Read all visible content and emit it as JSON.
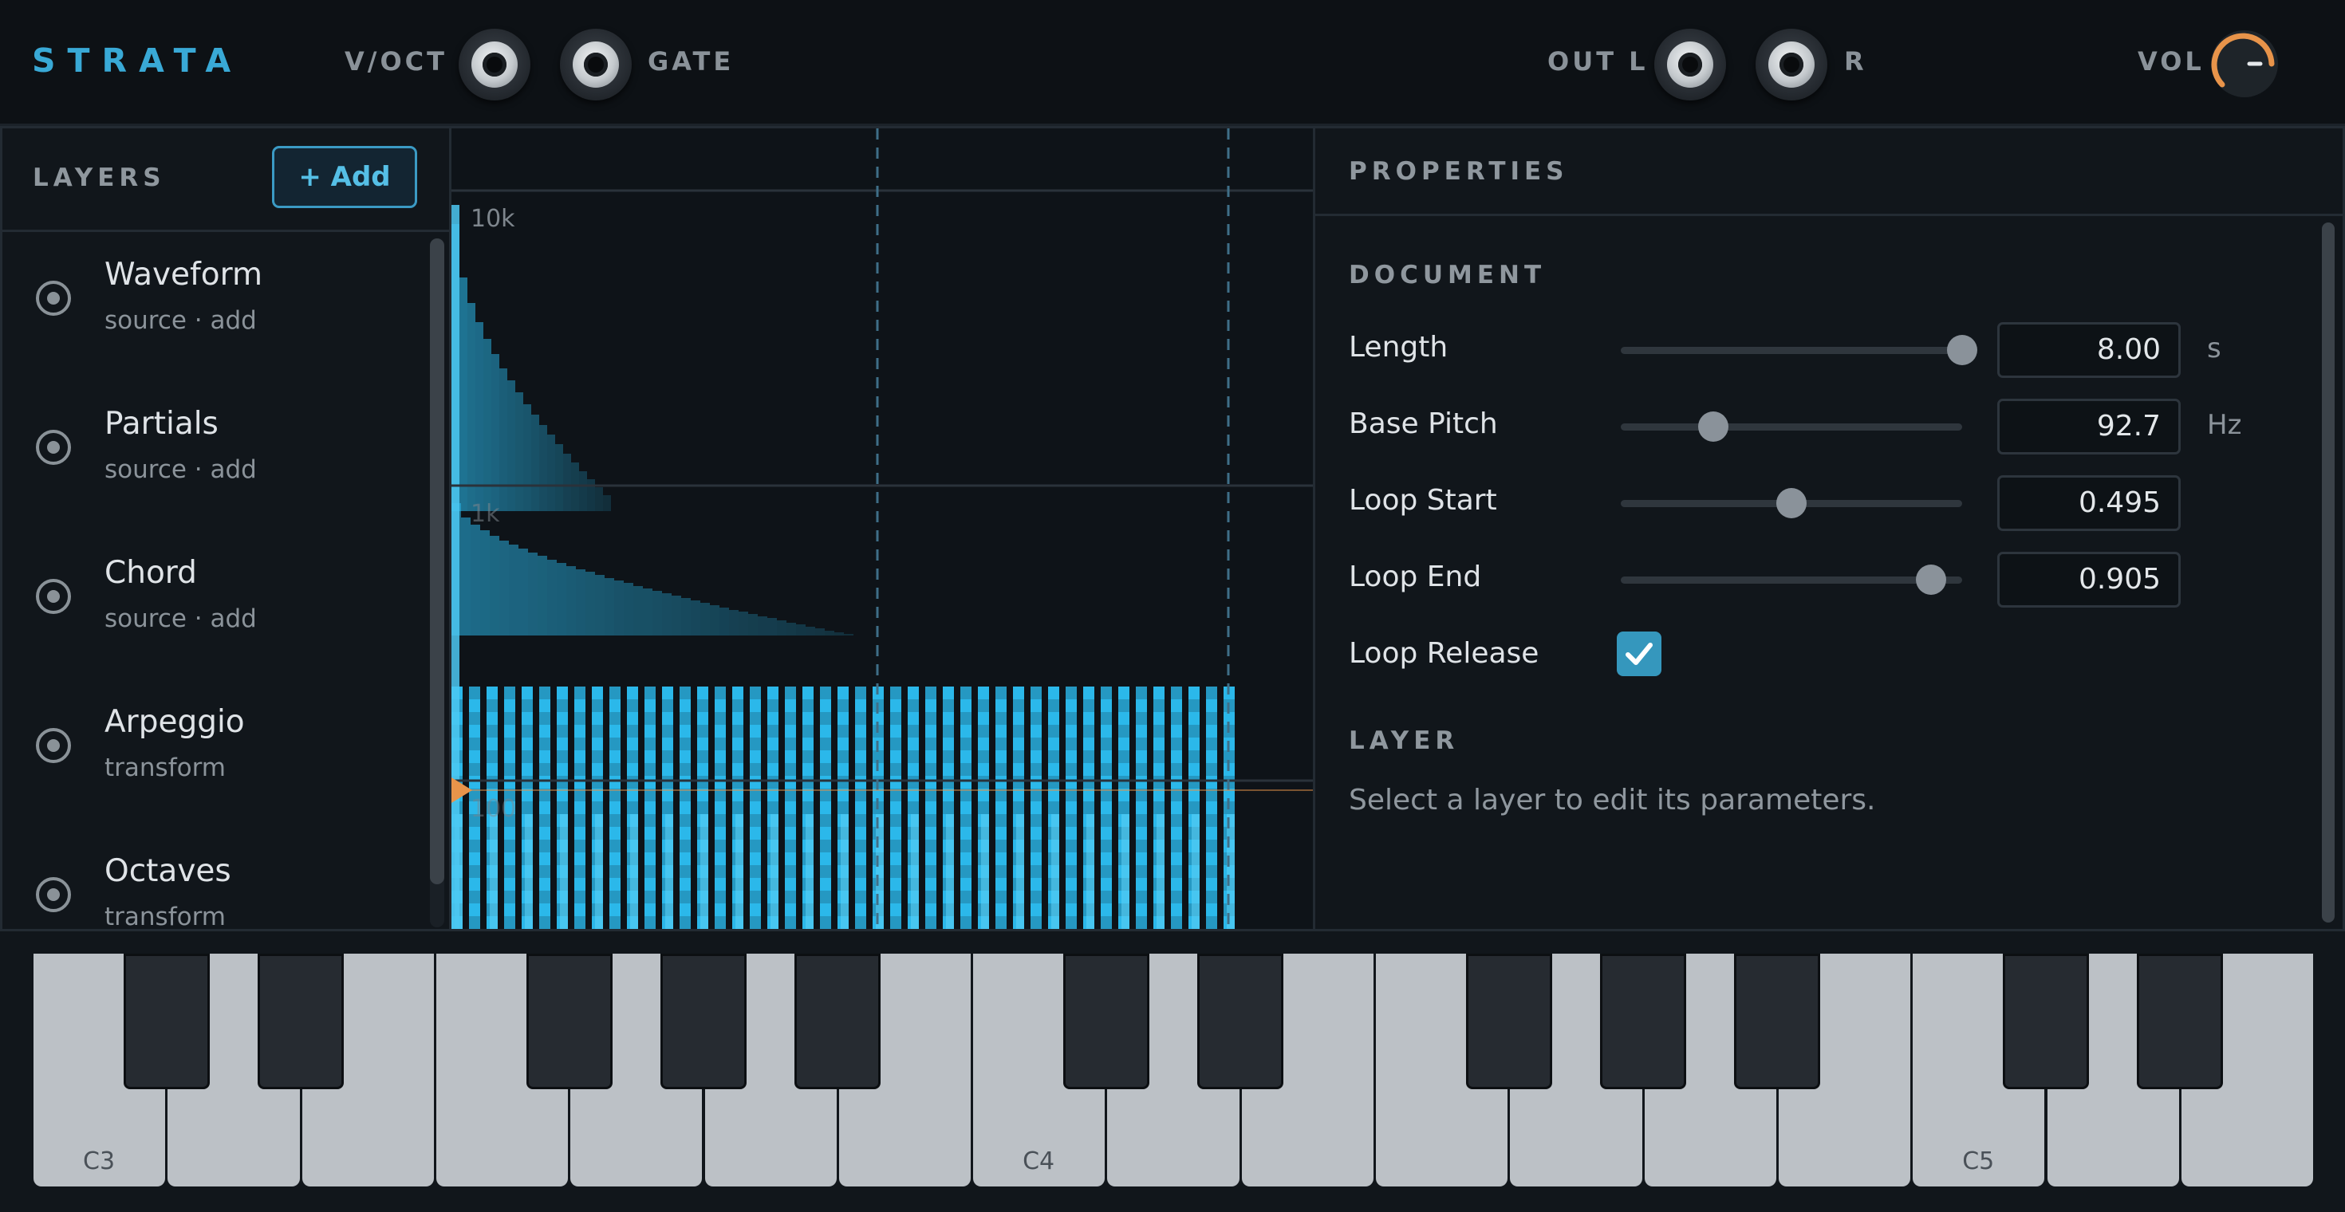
{
  "app": {
    "logo": "STRATA"
  },
  "header": {
    "cv_in_label": "V/OCT",
    "gate_label": "GATE",
    "out_l_label": "OUT L",
    "out_r_label": "R",
    "vol_label": "VOL"
  },
  "layers": {
    "title": "LAYERS",
    "add_label": "+ Add",
    "items": [
      {
        "name": "Waveform",
        "type": "source · add"
      },
      {
        "name": "Partials",
        "type": "source · add"
      },
      {
        "name": "Chord",
        "type": "source · add"
      },
      {
        "name": "Arpeggio",
        "type": "transform"
      },
      {
        "name": "Octaves",
        "type": "transform"
      }
    ]
  },
  "spectrogram": {
    "freq_labels": [
      "10k",
      "1k",
      "100"
    ]
  },
  "properties": {
    "title": "PROPERTIES",
    "document_title": "DOCUMENT",
    "length": {
      "label": "Length",
      "value": "8.00",
      "unit": "s",
      "slider_fraction": 1.0
    },
    "base_pitch": {
      "label": "Base Pitch",
      "value": "92.7",
      "unit": "Hz",
      "slider_fraction": 0.27
    },
    "loop_start": {
      "label": "Loop Start",
      "value": "0.495",
      "slider_fraction": 0.5
    },
    "loop_end": {
      "label": "Loop End",
      "value": "0.905",
      "slider_fraction": 0.91
    },
    "loop_release": {
      "label": "Loop Release",
      "checked": true
    },
    "layer_title": "LAYER",
    "layer_hint": "Select a layer to edit its parameters."
  },
  "keyboard": {
    "octave_labels": [
      "C3",
      "C4",
      "C5"
    ]
  },
  "colors": {
    "accent": "#39a9d6",
    "volume_arc": "#e8944a",
    "playhead": "#e8944a",
    "spectrum": "#2bb8ea"
  }
}
